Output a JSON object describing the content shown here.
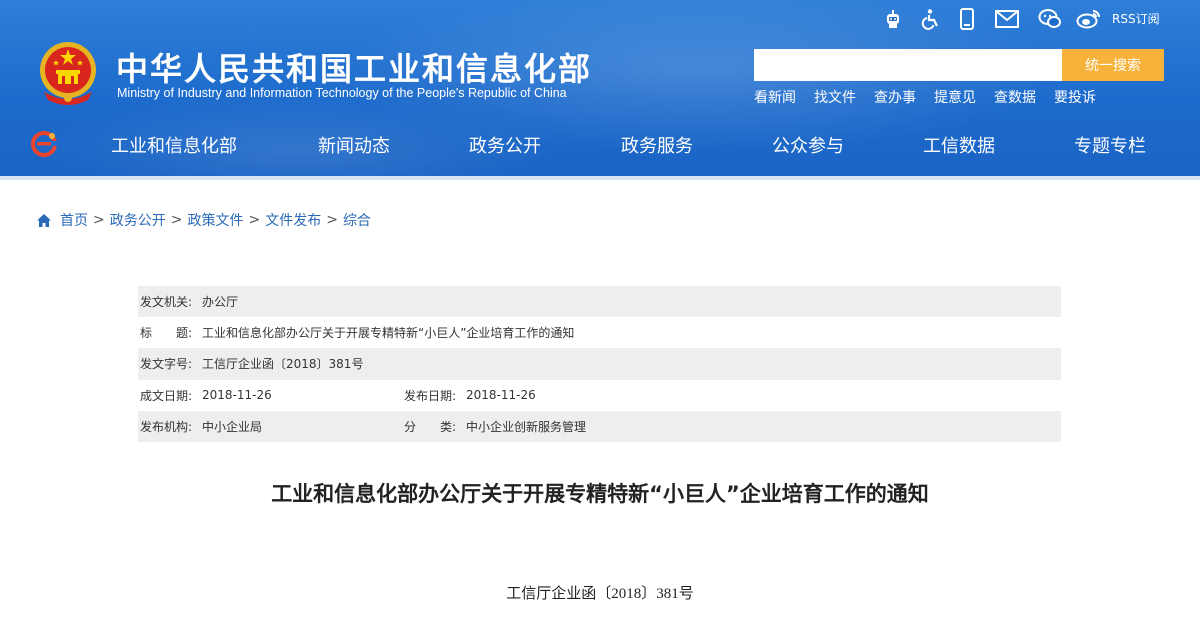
{
  "header": {
    "site_title": "中华人民共和国工业和信息化部",
    "site_subtitle": "Ministry of Industry and Information Technology of the People's Republic of China",
    "utility_icons": [
      "robot-icon",
      "accessibility-icon",
      "mobile-icon",
      "mail-icon",
      "wechat-icon",
      "weibo-icon"
    ],
    "rss_label": "RSS订阅",
    "search": {
      "placeholder": "",
      "value": "",
      "button_label": "统一搜索"
    },
    "quick_links": [
      "看新闻",
      "找文件",
      "查办事",
      "提意见",
      "查数据",
      "要投诉"
    ],
    "nav": [
      "工业和信息化部",
      "新闻动态",
      "政务公开",
      "政务服务",
      "公众参与",
      "工信数据",
      "专题专栏"
    ]
  },
  "breadcrumb": [
    "首页",
    "政务公开",
    "政策文件",
    "文件发布",
    "综合"
  ],
  "meta": {
    "issuer_label": "发文机关:",
    "issuer": "办公厅",
    "title_label": "标　　题:",
    "title": "工业和信息化部办公厅关于开展专精特新“小巨人”企业培育工作的通知",
    "doc_no_label": "发文字号:",
    "doc_no": "工信厅企业函〔2018〕381号",
    "created_label": "成文日期:",
    "created": "2018-11-26",
    "published_label": "发布日期:",
    "published": "2018-11-26",
    "org_label": "发布机构:",
    "org": "中小企业局",
    "category_label": "分　　类:",
    "category": "中小企业创新服务管理"
  },
  "document": {
    "title": "工业和信息化部办公厅关于开展专精特新“小巨人”企业培育工作的通知",
    "number": "工信厅企业函〔2018〕381号"
  },
  "colors": {
    "header_blue": "#1d6bcc",
    "search_button": "#f6b23a",
    "link_blue": "#2a6ab8",
    "row_shade": "#eeeeee"
  }
}
